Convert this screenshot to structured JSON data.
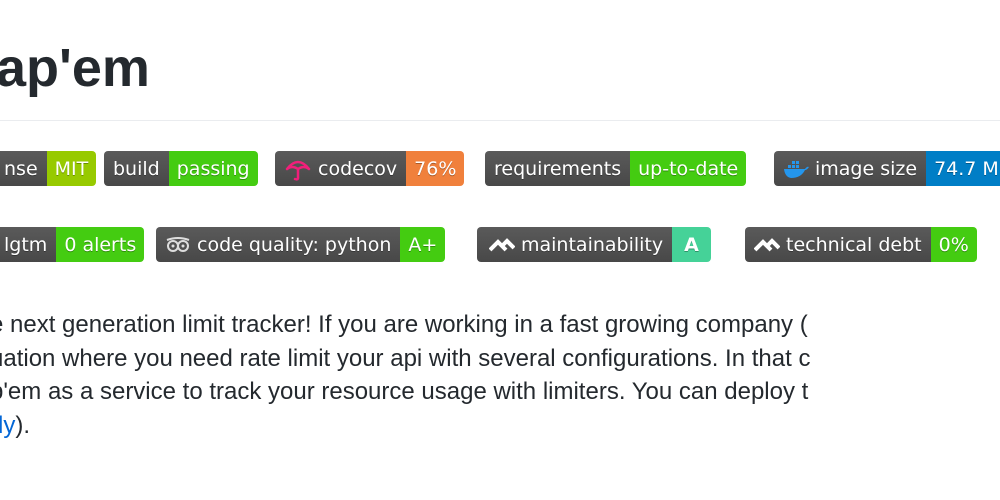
{
  "title": "ap'em",
  "badges_row1": [
    {
      "label": "nse",
      "value": "MIT",
      "color": "#97ca00"
    },
    {
      "label": "build",
      "value": "passing",
      "color": "#4c1"
    },
    {
      "label": "codecov",
      "value": "76%",
      "color": "#f0803c",
      "icon": "codecov-umbrella-icon"
    },
    {
      "label": "requirements",
      "value": "up-to-date",
      "color": "#4c1"
    },
    {
      "label": "image size",
      "value": "74.7 M",
      "color": "#007ec6",
      "icon": "docker-whale-icon"
    }
  ],
  "badges_row2": [
    {
      "label": "lgtm",
      "value": "0 alerts",
      "color": "#4c1"
    },
    {
      "label": "code quality: python",
      "value": "A+",
      "color": "#4c1",
      "icon": "lgtm-owl-icon"
    },
    {
      "label": "maintainability",
      "value": "A",
      "color": "#45d298",
      "icon": "codeclimate-icon"
    },
    {
      "label": "technical debt",
      "value": "0%",
      "color": "#4c1",
      "icon": "codeclimate-icon"
    }
  ],
  "paragraph": {
    "line1": "e next generation limit tracker! If you are working in a fast growing company (",
    "line2": "uation where you need rate limit your api with several configurations. In that c",
    "line3": "p'em as a service to track your resource usage with limiters. You can deploy t",
    "link": "dy",
    "line4_end": ")."
  }
}
